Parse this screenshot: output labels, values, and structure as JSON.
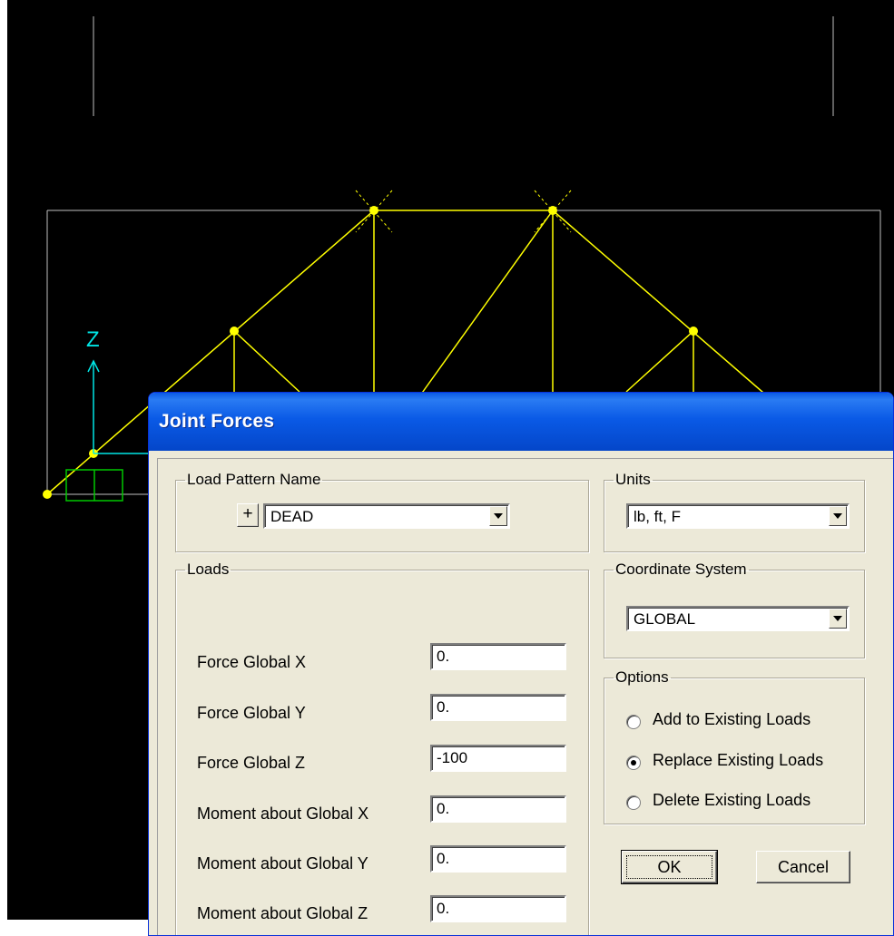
{
  "colors": {
    "canvas": "#000000",
    "truss": "#ffff00",
    "axis": "#00e5e5",
    "support": "#00c800",
    "grid": "#c0c0c0"
  },
  "model": {
    "axis_label": "Z"
  },
  "dialog": {
    "title": "Joint Forces",
    "load_pattern": {
      "group_label": "Load Pattern Name",
      "add_label": "+",
      "selected": "DEAD"
    },
    "units": {
      "group_label": "Units",
      "selected": "lb, ft, F"
    },
    "coordinate_system": {
      "group_label": "Coordinate System",
      "selected": "GLOBAL"
    },
    "loads": {
      "group_label": "Loads",
      "fields": [
        {
          "label": "Force Global X",
          "value": "0."
        },
        {
          "label": "Force Global Y",
          "value": "0."
        },
        {
          "label": "Force Global Z",
          "value": "-100"
        },
        {
          "label": "Moment about Global X",
          "value": "0."
        },
        {
          "label": "Moment about Global Y",
          "value": "0."
        },
        {
          "label": "Moment about Global Z",
          "value": "0."
        }
      ]
    },
    "options": {
      "group_label": "Options",
      "items": [
        {
          "label": "Add to Existing Loads",
          "selected": false
        },
        {
          "label": "Replace Existing Loads",
          "selected": true
        },
        {
          "label": "Delete Existing Loads",
          "selected": false
        }
      ]
    },
    "ok_label": "OK",
    "cancel_label": "Cancel"
  }
}
